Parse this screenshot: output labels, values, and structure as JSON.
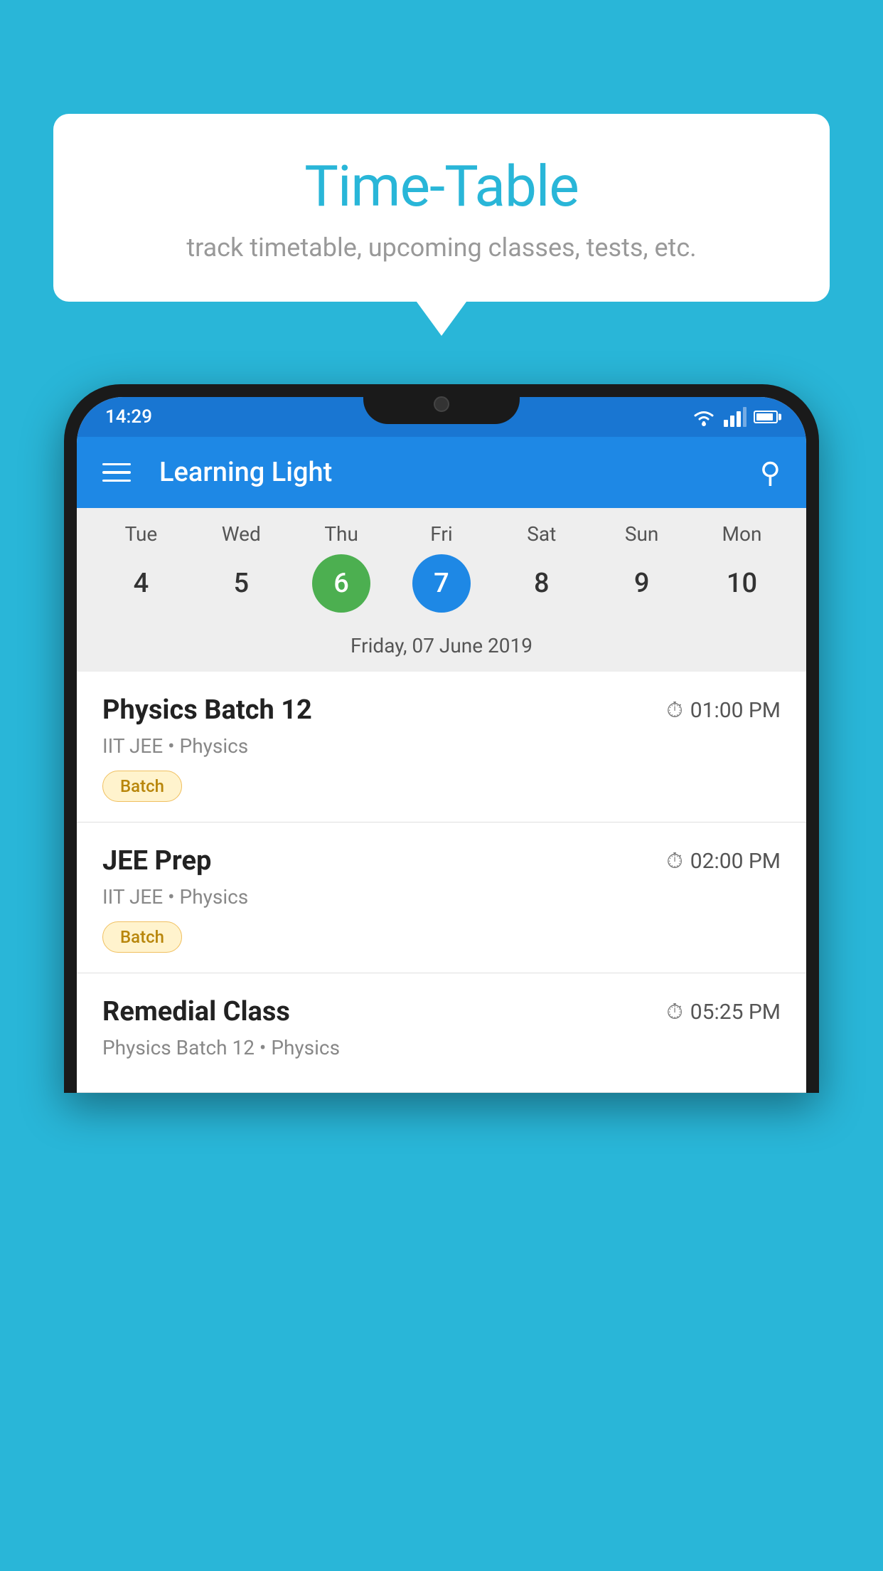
{
  "background": {
    "color": "#29b6d8"
  },
  "bubble": {
    "title": "Time-Table",
    "subtitle": "track timetable, upcoming classes, tests, etc."
  },
  "phone": {
    "status_bar": {
      "time": "14:29"
    },
    "toolbar": {
      "app_name": "Learning Light"
    },
    "calendar": {
      "days": [
        "Tue",
        "Wed",
        "Thu",
        "Fri",
        "Sat",
        "Sun",
        "Mon"
      ],
      "dates": [
        "4",
        "5",
        "6",
        "7",
        "8",
        "9",
        "10"
      ],
      "today_index": 2,
      "selected_index": 3,
      "selected_date_label": "Friday, 07 June 2019"
    },
    "schedule": [
      {
        "title": "Physics Batch 12",
        "time": "01:00 PM",
        "meta": "IIT JEE • Physics",
        "badge": "Batch"
      },
      {
        "title": "JEE Prep",
        "time": "02:00 PM",
        "meta": "IIT JEE • Physics",
        "badge": "Batch"
      },
      {
        "title": "Remedial Class",
        "time": "05:25 PM",
        "meta": "Physics Batch 12 • Physics",
        "badge": null
      }
    ]
  }
}
